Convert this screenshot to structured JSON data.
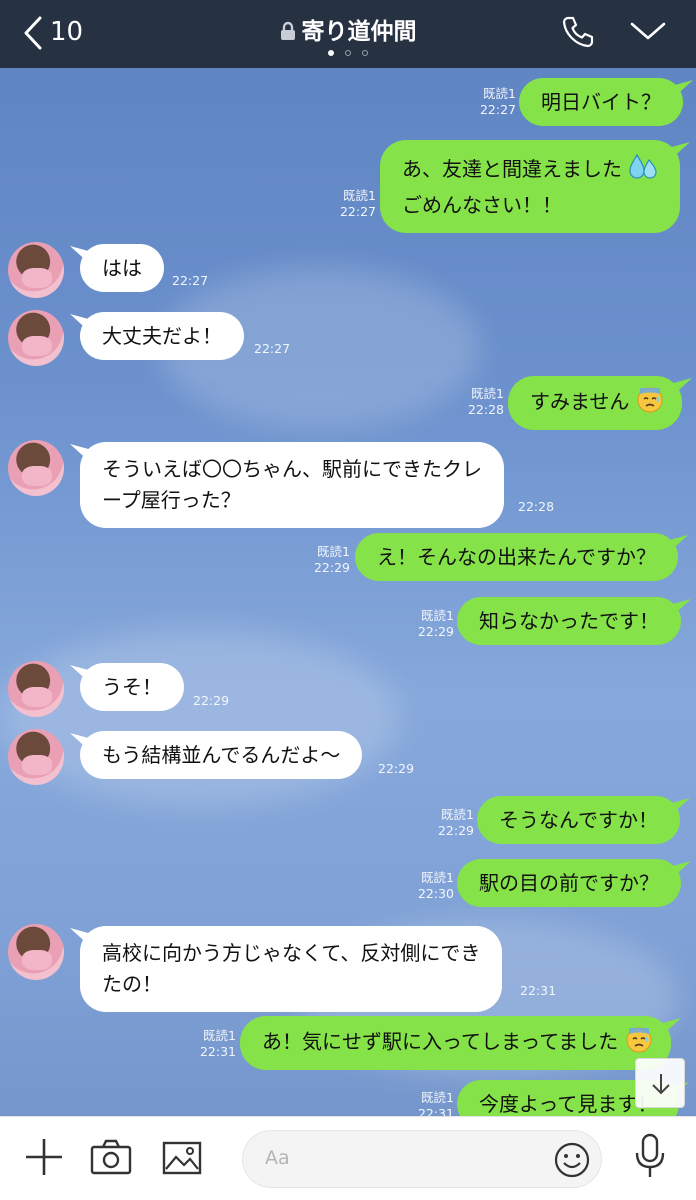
{
  "header": {
    "back_count": "10",
    "title": "寄り道仲間",
    "page_dots": 3,
    "active_dot": 0
  },
  "messages": [
    {
      "side": "right",
      "text": "明日バイト？",
      "read": "既読1",
      "time": "22:27"
    },
    {
      "side": "right",
      "lines": [
        "あ、友達と間違えました",
        "ごめんなさい！！"
      ],
      "emoji": "sweat-drops",
      "read": "既読1",
      "time": "22:27"
    },
    {
      "side": "left",
      "text": "はは",
      "time": "22:27"
    },
    {
      "side": "left",
      "text": "大丈夫だよ！",
      "time": "22:27"
    },
    {
      "side": "right",
      "text": "すみません",
      "emoji": "sad-sweat-face",
      "read": "既読1",
      "time": "22:28"
    },
    {
      "side": "left",
      "lines": [
        "そういえば〇〇ちゃん、駅前にできたクレ",
        "ープ屋行った？"
      ],
      "time": "22:28"
    },
    {
      "side": "right",
      "text": "え！そんなの出来たんですか？",
      "read": "既読1",
      "time": "22:29"
    },
    {
      "side": "right",
      "text": "知らなかったです！",
      "read": "既読1",
      "time": "22:29"
    },
    {
      "side": "left",
      "text": "うそ！",
      "time": "22:29"
    },
    {
      "side": "left",
      "text": "もう結構並んでるんだよ〜",
      "time": "22:29"
    },
    {
      "side": "right",
      "text": "そうなんですか！",
      "read": "既読1",
      "time": "22:29"
    },
    {
      "side": "right",
      "text": "駅の目の前ですか？",
      "read": "既読1",
      "time": "22:30"
    },
    {
      "side": "left",
      "lines": [
        "高校に向かう方じゃなくて、反対側にでき",
        "たの！"
      ],
      "time": "22:31"
    },
    {
      "side": "right",
      "text": "あ！気にせず駅に入ってしまってました",
      "emoji": "sad-sweat-face",
      "read": "既読1",
      "time": "22:31"
    },
    {
      "side": "right",
      "text": "今度よって見ます！",
      "read": "既読1",
      "time": "22:31"
    }
  ],
  "input": {
    "placeholder": "Aa"
  },
  "colors": {
    "header": "#263142",
    "sent_bubble": "#85e249",
    "received_bubble": "#ffffff",
    "chat_bg": "#6f93cc"
  }
}
